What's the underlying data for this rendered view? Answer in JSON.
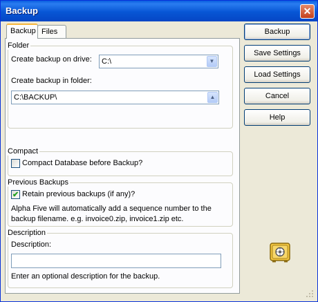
{
  "window": {
    "title": "Backup",
    "close_glyph": "✕"
  },
  "tabs": [
    {
      "label": "Backup"
    },
    {
      "label": "Files"
    }
  ],
  "folder": {
    "group_title": "Folder",
    "drive_label": "Create backup on drive:",
    "drive_value": "C:\\",
    "folder_label": "Create backup in folder:",
    "folder_value": "C:\\BACKUP\\"
  },
  "compact": {
    "group_title": "Compact",
    "checkbox_label": "Compact Database before Backup?",
    "checked": false
  },
  "previous": {
    "group_title": "Previous Backups",
    "checkbox_label": "Retain previous backups (if any)?",
    "checked": true,
    "note_line1": "Alpha Five will automatically add a sequence number to the",
    "note_line2": "backup filename. e.g. invoice0.zip, invoice1.zip etc."
  },
  "description": {
    "group_title": "Description",
    "field_label": "Description:",
    "value": "",
    "hint": "Enter an optional description for the backup."
  },
  "buttons": {
    "backup": "Backup",
    "save_settings": "Save Settings",
    "load_settings": "Load Settings",
    "cancel": "Cancel",
    "help": "Help"
  },
  "icons": {
    "close": "close-icon",
    "safe": "safe-icon",
    "dropdown": "chevron-down-icon",
    "dropup": "chevron-up-icon"
  },
  "colors": {
    "titlebar": "#0756d5",
    "face": "#ece9d8",
    "check": "#21a121"
  }
}
